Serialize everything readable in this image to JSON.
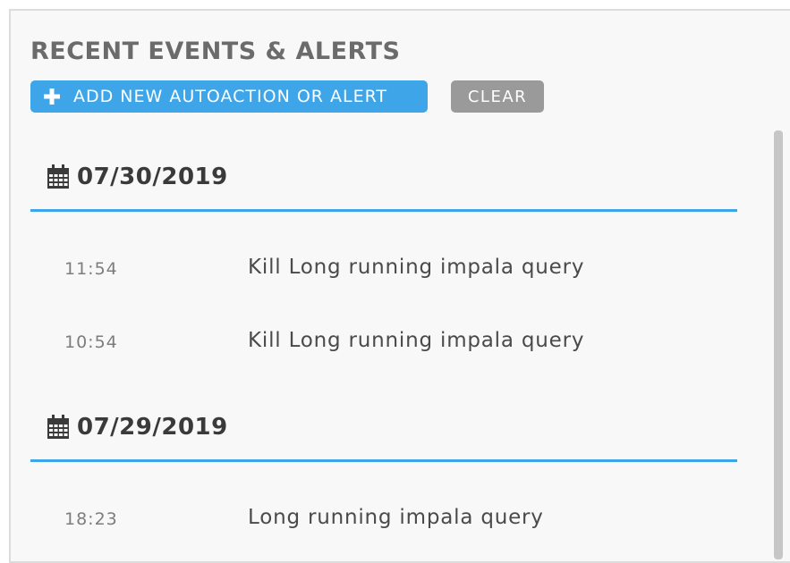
{
  "header": {
    "title": "RECENT EVENTS & ALERTS"
  },
  "toolbar": {
    "add_label": "ADD NEW AUTOACTION OR ALERT",
    "clear_label": "CLEAR"
  },
  "icons": {
    "add": "plus-icon",
    "date": "calendar-icon"
  },
  "colors": {
    "accent": "#3ea6e8",
    "clear_button": "#9a9a9a",
    "title": "#6b6b6b"
  },
  "groups": [
    {
      "date": "07/30/2019",
      "events": [
        {
          "time": "11:54",
          "text": "Kill Long running impala query"
        },
        {
          "time": "10:54",
          "text": "Kill Long running impala query"
        }
      ]
    },
    {
      "date": "07/29/2019",
      "events": [
        {
          "time": "18:23",
          "text": "Long running impala query"
        }
      ]
    }
  ]
}
